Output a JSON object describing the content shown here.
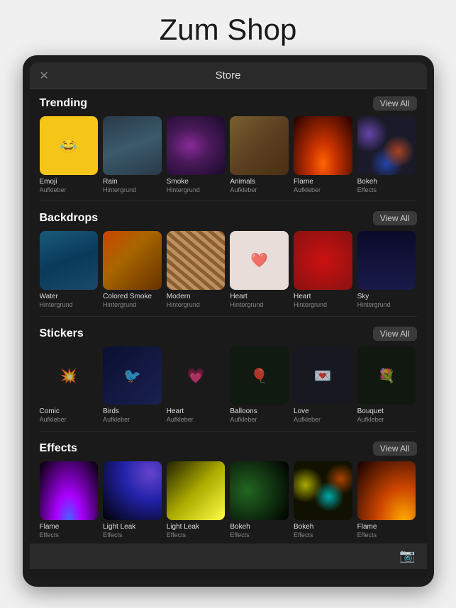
{
  "page": {
    "title": "Zum Shop"
  },
  "store": {
    "header_title": "Store",
    "close_label": "✕",
    "sections": [
      {
        "id": "trending",
        "title": "Trending",
        "view_all_label": "View All",
        "items": [
          {
            "name": "Emoji",
            "sub": "Aufkleber",
            "thumb_class": "thumb-emoji",
            "icon": "😂"
          },
          {
            "name": "Rain",
            "sub": "Hintergrund",
            "thumb_class": "rain-drops"
          },
          {
            "name": "Smoke",
            "sub": "Hintergrund",
            "thumb_class": "smoke-purple"
          },
          {
            "name": "Animals",
            "sub": "Aufkleber",
            "thumb_class": "animals-bg"
          },
          {
            "name": "Flame",
            "sub": "Aufkleber",
            "thumb_class": "flame-orange"
          },
          {
            "name": "Bokeh",
            "sub": "Effects",
            "thumb_class": "bokeh-colors"
          }
        ]
      },
      {
        "id": "backdrops",
        "title": "Backdrops",
        "view_all_label": "View All",
        "items": [
          {
            "name": "Water",
            "sub": "Hintergrund",
            "thumb_class": "water-blue"
          },
          {
            "name": "Colored Smoke",
            "sub": "Hintergrund",
            "thumb_class": "colored-smoke-bg"
          },
          {
            "name": "Modern",
            "sub": "Hintergrund",
            "thumb_class": "modern-stripe"
          },
          {
            "name": "Heart",
            "sub": "Hintergrund",
            "thumb_class": "heart-white",
            "icon": "❤️"
          },
          {
            "name": "Heart",
            "sub": "Hintergrund",
            "thumb_class": "heart-red"
          },
          {
            "name": "Sky",
            "sub": "Hintergrund",
            "thumb_class": "sky-stars"
          }
        ]
      },
      {
        "id": "stickers",
        "title": "Stickers",
        "view_all_label": "View All",
        "items": [
          {
            "name": "Comic",
            "sub": "Aufkleber",
            "thumb_class": "comic-bg",
            "icon": "💥"
          },
          {
            "name": "Birds",
            "sub": "Aufkleber",
            "thumb_class": "birds-bg",
            "icon": "🐦"
          },
          {
            "name": "Heart",
            "sub": "Aufkleber",
            "thumb_class": "heart-stroke-bg",
            "icon": "💗"
          },
          {
            "name": "Balloons",
            "sub": "Aufkleber",
            "thumb_class": "balloons-bg",
            "icon": "🎈"
          },
          {
            "name": "Love",
            "sub": "Aufkleber",
            "thumb_class": "love-text-bg",
            "icon": "💌"
          },
          {
            "name": "Bouquet",
            "sub": "Aufkleber",
            "thumb_class": "bouquet-bg",
            "icon": "💐"
          }
        ]
      },
      {
        "id": "effects",
        "title": "Effects",
        "view_all_label": "View All",
        "items": [
          {
            "name": "Flame",
            "sub": "Effects",
            "thumb_class": "flame-effect-bg"
          },
          {
            "name": "Light Leak",
            "sub": "Effects",
            "thumb_class": "lightleak1-bg"
          },
          {
            "name": "Light Leak",
            "sub": "Effects",
            "thumb_class": "lightleak2-bg"
          },
          {
            "name": "Bokeh",
            "sub": "Effects",
            "thumb_class": "bokeh-green"
          },
          {
            "name": "Bokeh",
            "sub": "Effects",
            "thumb_class": "bokeh-multi"
          },
          {
            "name": "Flame",
            "sub": "Effects",
            "thumb_class": "flame-spark"
          }
        ]
      }
    ]
  }
}
